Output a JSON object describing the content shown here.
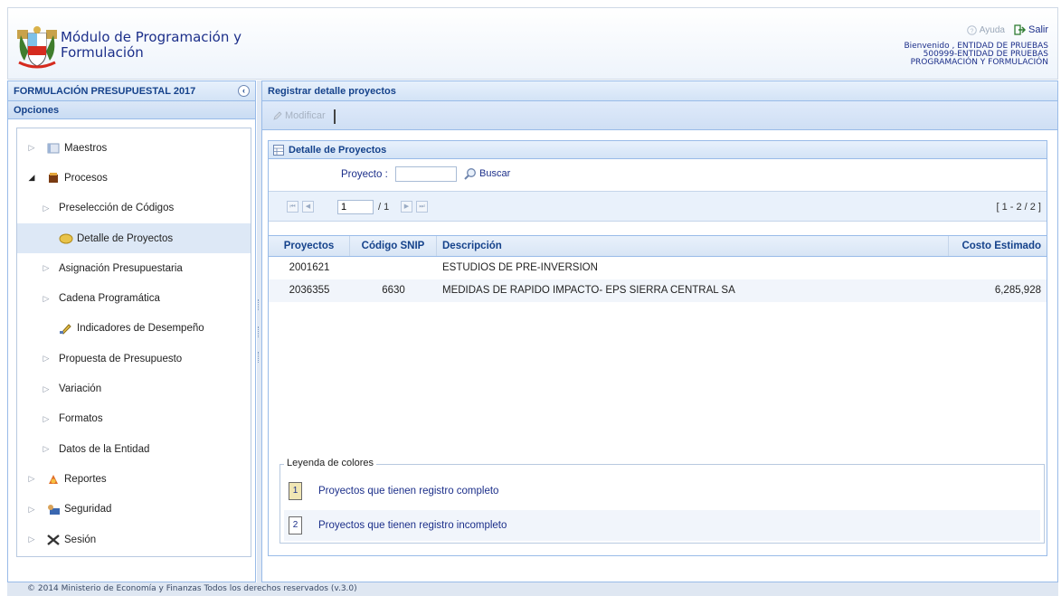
{
  "header": {
    "title_line1": "Módulo de Programación y",
    "title_line2": "Formulación",
    "help_label": "Ayuda",
    "exit_label": "Salir",
    "welcome_line1": "Bienvenido , ENTIDAD DE PRUEBAS",
    "welcome_line2": "500999-ENTIDAD DE PRUEBAS",
    "welcome_line3": "PROGRAMACIÓN Y FORMULACIÓN"
  },
  "sidebar": {
    "title": "FORMULACIÓN PRESUPUESTAL 2017",
    "options_label": "Opciones",
    "items": [
      {
        "label": "Maestros"
      },
      {
        "label": "Procesos"
      },
      {
        "label": "Preselección de Códigos"
      },
      {
        "label": "Detalle de Proyectos"
      },
      {
        "label": "Asignación Presupuestaria"
      },
      {
        "label": "Cadena Programática"
      },
      {
        "label": "Indicadores de Desempeño"
      },
      {
        "label": "Propuesta de Presupuesto"
      },
      {
        "label": "Variación"
      },
      {
        "label": "Formatos"
      },
      {
        "label": "Datos de la Entidad"
      },
      {
        "label": "Reportes"
      },
      {
        "label": "Seguridad"
      },
      {
        "label": "Sesión"
      }
    ]
  },
  "main": {
    "title": "Registrar detalle proyectos",
    "modify_label": "Modificar",
    "detail_title": "Detalle de Proyectos",
    "search": {
      "label": "Proyecto :",
      "value": "",
      "button_label": "Buscar"
    },
    "pager": {
      "page": "1",
      "total": "/ 1",
      "range": "[ 1 - 2 / 2 ]"
    },
    "table": {
      "headers": [
        "Proyectos",
        "Código SNIP",
        "Descripción",
        "Costo Estimado"
      ],
      "rows": [
        {
          "proyecto": "2001621",
          "snip": "",
          "descripcion": "ESTUDIOS DE PRE-INVERSION",
          "costo": ""
        },
        {
          "proyecto": "2036355",
          "snip": "6630",
          "descripcion": "MEDIDAS DE RAPIDO IMPACTO- EPS SIERRA CENTRAL SA",
          "costo": "6,285,928"
        }
      ]
    },
    "legend": {
      "title": "Leyenda de colores",
      "items": [
        {
          "key": "1",
          "text": "Proyectos que tienen registro completo",
          "color": "#f0e6b4"
        },
        {
          "key": "2",
          "text": "Proyectos que tienen registro incompleto",
          "color": "#ffffff"
        }
      ]
    }
  },
  "footer": {
    "text": "© 2014 Ministerio de Economía y Finanzas Todos los derechos reservados (v.3.0)"
  },
  "colors": {
    "accent": "#15428b",
    "panel_border": "#99bbe8",
    "selected_row": "#dde8f6"
  }
}
